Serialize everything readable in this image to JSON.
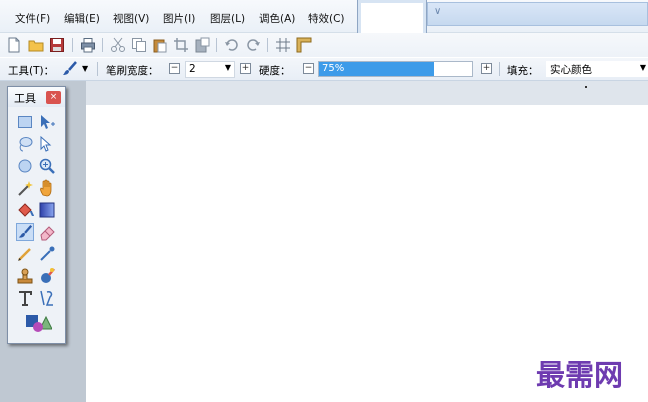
{
  "menu": {
    "items": [
      "文件(F)",
      "编辑(E)",
      "视图(V)",
      "图片(I)",
      "图层(L)",
      "调色(A)",
      "特效(C)"
    ]
  },
  "toolbar": {
    "icons": [
      "new-file-icon",
      "open-folder-icon",
      "save-icon",
      "print-icon",
      "cut-icon",
      "copy-icon",
      "paste-icon",
      "crop-icon",
      "paste-into-icon",
      "undo-icon",
      "redo-icon",
      "grid-icon",
      "ruler-icon"
    ]
  },
  "settings": {
    "tool_label": "工具(T)：",
    "brush_width_label": "笔刷宽度：",
    "brush_width_value": "2",
    "hardness_label": "硬度：",
    "hardness_value": "75%",
    "hardness_fraction": 0.75,
    "fill_label": "填充：",
    "fill_value": "实心颜色"
  },
  "palette": {
    "title": "工具",
    "tools": [
      "rectangle-select",
      "move-selection",
      "lasso-select",
      "move-selected",
      "ellipse-select",
      "zoom",
      "magic-wand",
      "pan",
      "paint-bucket",
      "gradient",
      "paintbrush",
      "eraser",
      "pencil",
      "color-picker",
      "clone-stamp",
      "recolor",
      "text",
      "line-curve",
      "shapes"
    ],
    "selected": "paintbrush"
  },
  "watermark": "最需网",
  "colors": {
    "accent": "#3d9be9",
    "watermark": "#6e3bb0",
    "close": "#d9534f"
  }
}
